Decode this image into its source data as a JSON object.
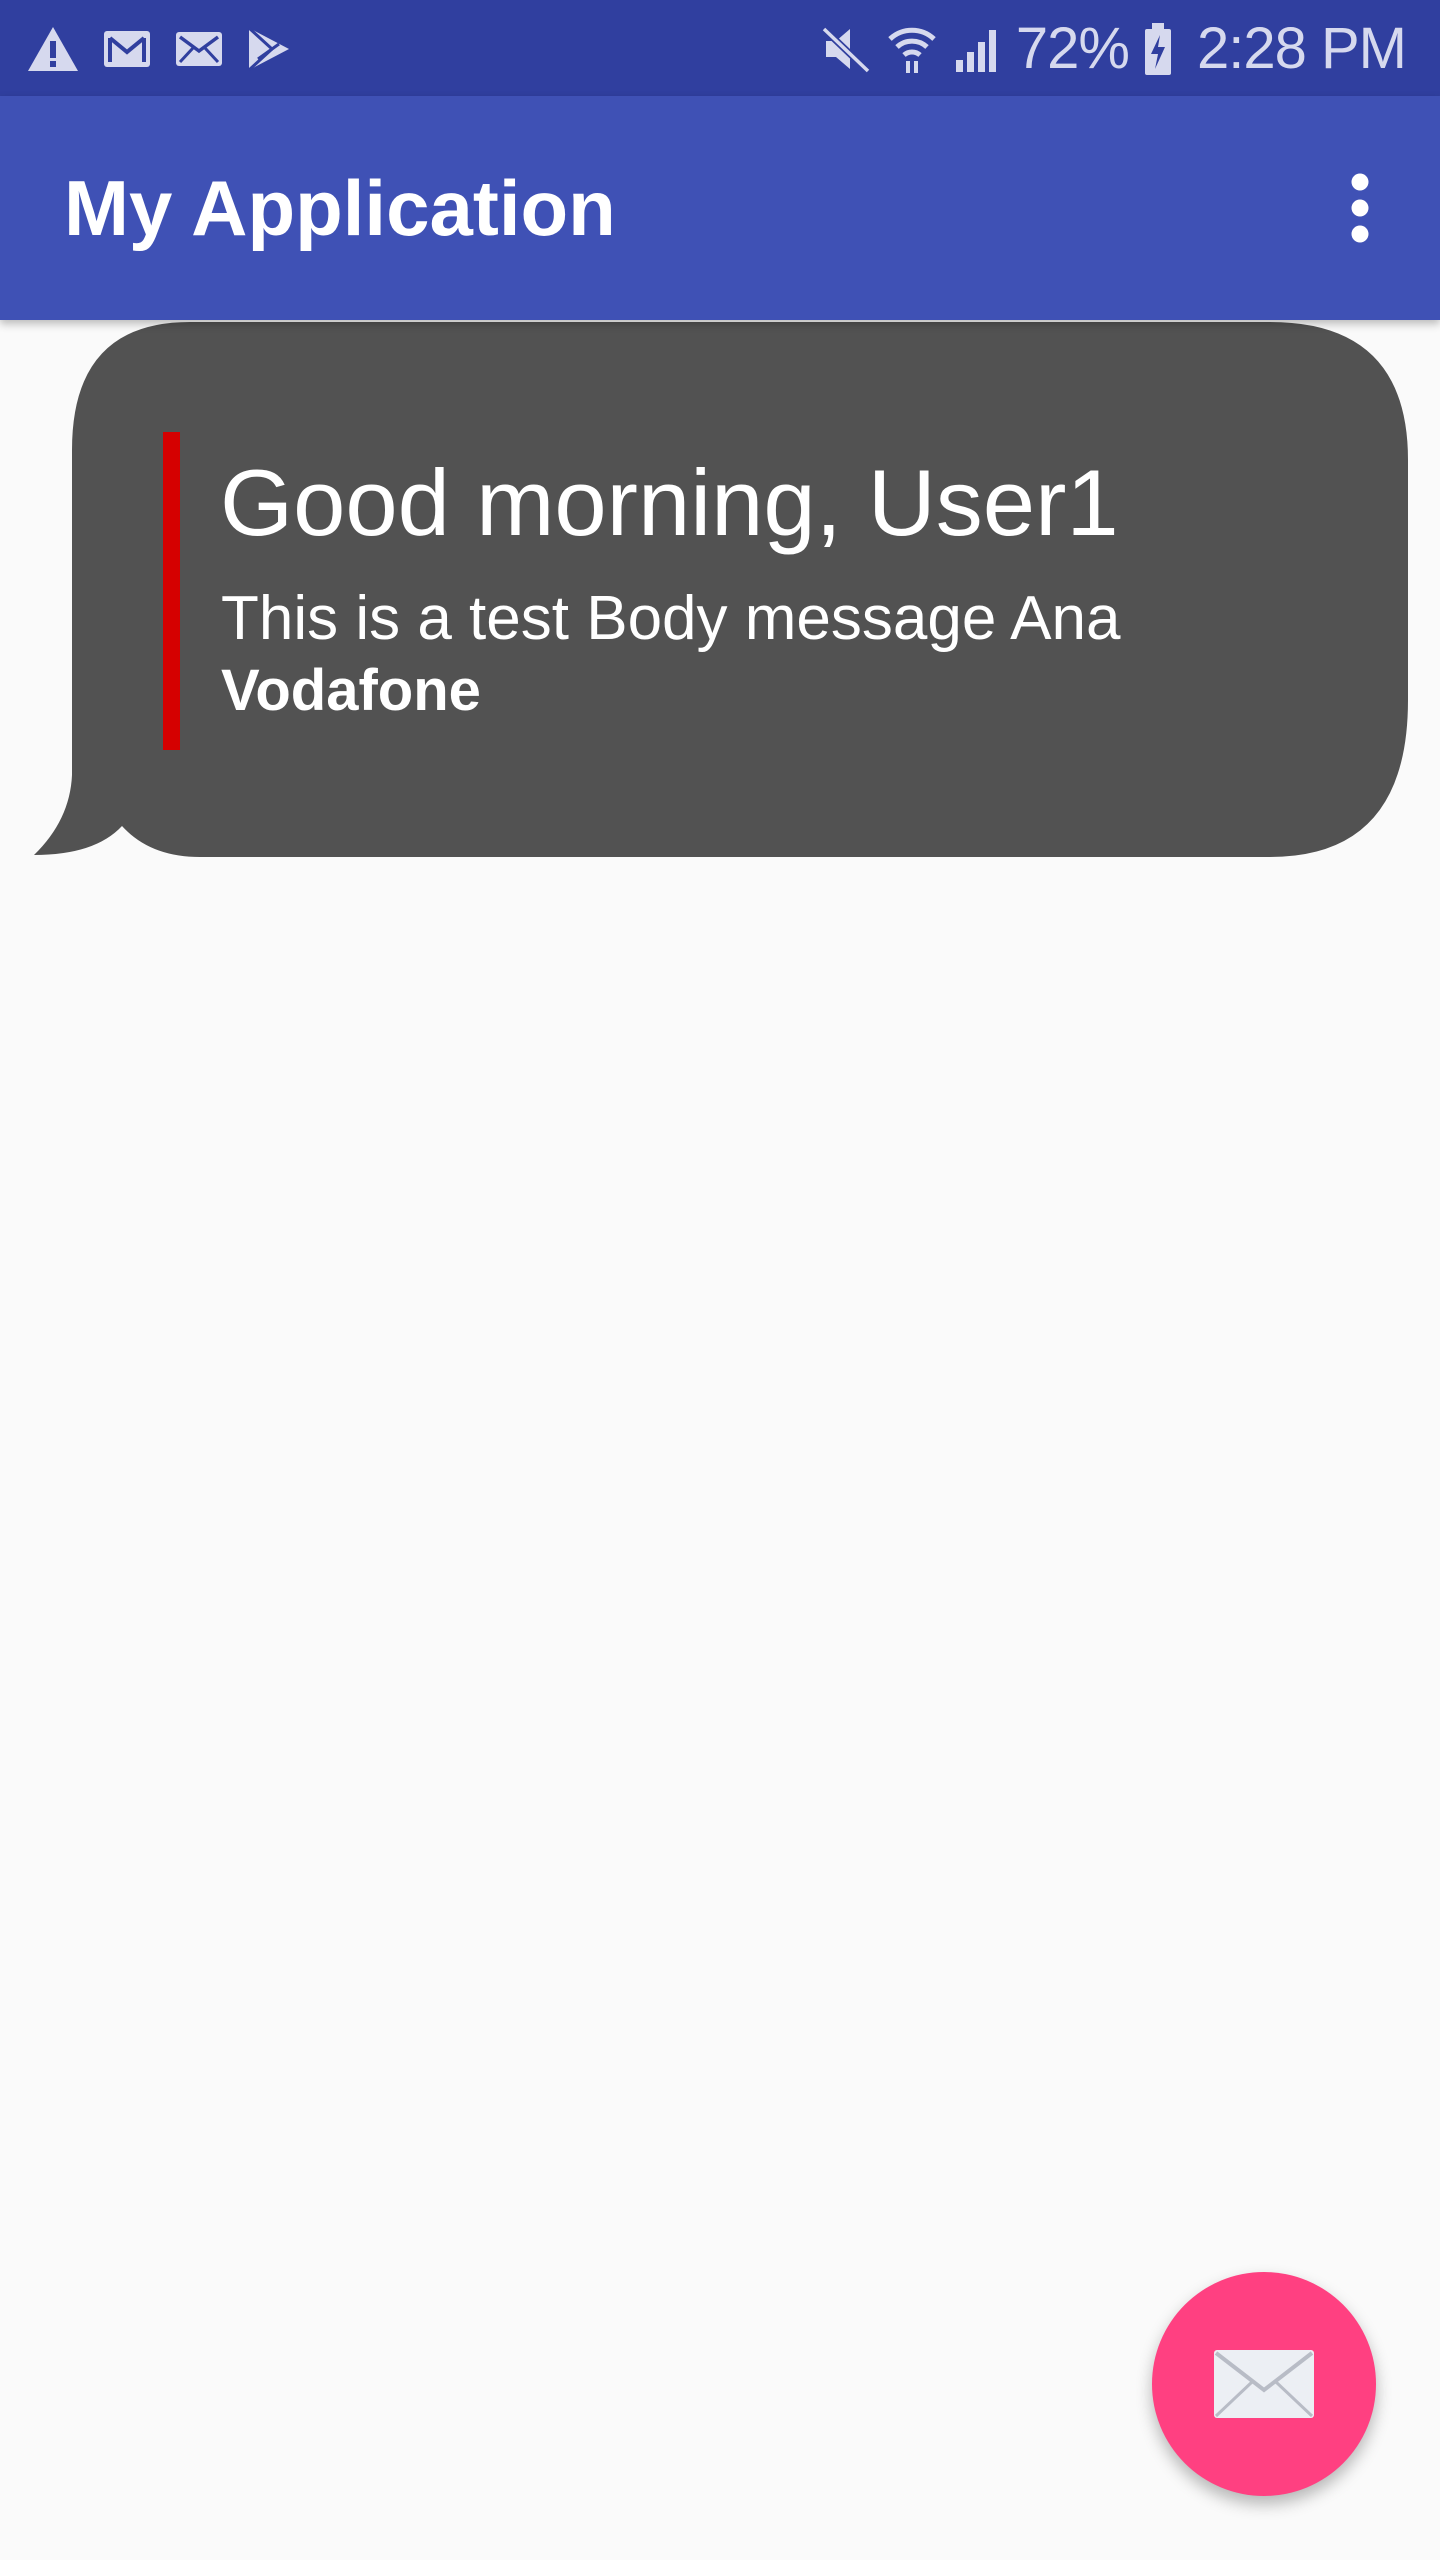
{
  "status_bar": {
    "left_icons": [
      "warning-icon",
      "gmail-icon",
      "email-icon",
      "play-store-icon"
    ],
    "right_icons": [
      "mute-icon",
      "wifi-icon",
      "signal-icon",
      "battery-charging-icon"
    ],
    "battery_percent": "72%",
    "time": "2:28 PM"
  },
  "app_bar": {
    "title": "My Application",
    "overflow_icon": "more-vert-icon"
  },
  "message": {
    "title": "Good morning, User1",
    "body": "This is a test Body message Ana",
    "sender": "Vodafone",
    "bubble_color": "#525252",
    "accent_color": "#d50000"
  },
  "fab": {
    "icon": "envelope-icon",
    "color": "#ff4081"
  },
  "colors": {
    "status_bar": "#303f9f",
    "primary": "#3f51b5",
    "background": "#fafafa"
  }
}
